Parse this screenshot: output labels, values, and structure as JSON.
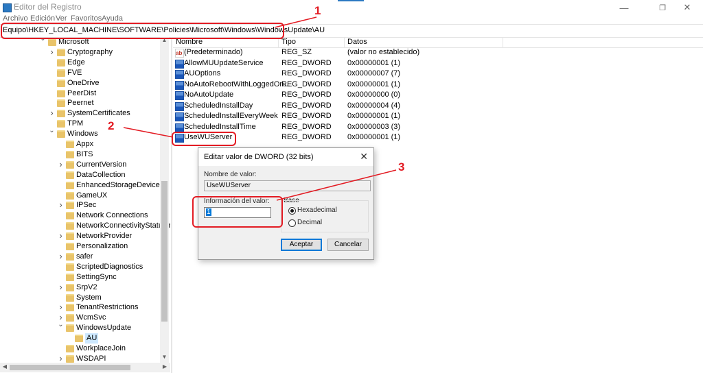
{
  "window": {
    "title": "Editor del Registro",
    "icons": {
      "app": "regedit-icon",
      "minimize": "minimize-icon",
      "maximize": "maximize-icon",
      "close": "close-icon"
    }
  },
  "menu": [
    "Archivo",
    "Edición",
    "Ver",
    "Favoritos",
    "Ayuda"
  ],
  "address": "Equipo\\HKEY_LOCAL_MACHINE\\SOFTWARE\\Policies\\Microsoft\\Windows\\WindowsUpdate\\AU",
  "tree": [
    {
      "label": "Microsoft",
      "expander": "expanded"
    },
    {
      "label": "Cryptography",
      "expander": "collapsed"
    },
    {
      "label": "Edge",
      "expander": "none"
    },
    {
      "label": "FVE",
      "expander": "none"
    },
    {
      "label": "OneDrive",
      "expander": "none"
    },
    {
      "label": "PeerDist",
      "expander": "none"
    },
    {
      "label": "Peernet",
      "expander": "none"
    },
    {
      "label": "SystemCertificates",
      "expander": "collapsed"
    },
    {
      "label": "TPM",
      "expander": "none"
    },
    {
      "label": "Windows",
      "expander": "expanded"
    },
    {
      "label": "Appx",
      "expander": "none"
    },
    {
      "label": "BITS",
      "expander": "none"
    },
    {
      "label": "CurrentVersion",
      "expander": "collapsed"
    },
    {
      "label": "DataCollection",
      "expander": "none"
    },
    {
      "label": "EnhancedStorageDevices",
      "expander": "none"
    },
    {
      "label": "GameUX",
      "expander": "none"
    },
    {
      "label": "IPSec",
      "expander": "collapsed"
    },
    {
      "label": "Network Connections",
      "expander": "none"
    },
    {
      "label": "NetworkConnectivityStatusInd",
      "expander": "none"
    },
    {
      "label": "NetworkProvider",
      "expander": "collapsed"
    },
    {
      "label": "Personalization",
      "expander": "none"
    },
    {
      "label": "safer",
      "expander": "collapsed"
    },
    {
      "label": "ScriptedDiagnostics",
      "expander": "none"
    },
    {
      "label": "SettingSync",
      "expander": "none"
    },
    {
      "label": "SrpV2",
      "expander": "collapsed"
    },
    {
      "label": "System",
      "expander": "none"
    },
    {
      "label": "TenantRestrictions",
      "expander": "collapsed"
    },
    {
      "label": "WcmSvc",
      "expander": "collapsed"
    },
    {
      "label": "WindowsUpdate",
      "expander": "expanded"
    },
    {
      "label": "AU",
      "expander": "none",
      "selected": true
    },
    {
      "label": "WorkplaceJoin",
      "expander": "none"
    },
    {
      "label": "WSDAPI",
      "expander": "collapsed"
    }
  ],
  "list": {
    "headers": {
      "name": "Nombre",
      "type": "Tipo",
      "data": "Datos"
    },
    "rows": [
      {
        "name": "(Predeterminado)",
        "type": "REG_SZ",
        "data": "(valor no establecido)",
        "icon": "string-value-icon"
      },
      {
        "name": "AllowMUUpdateService",
        "type": "REG_DWORD",
        "data": "0x00000001 (1)",
        "icon": "dword-value-icon"
      },
      {
        "name": "AUOptions",
        "type": "REG_DWORD",
        "data": "0x00000007 (7)",
        "icon": "dword-value-icon"
      },
      {
        "name": "NoAutoRebootWithLoggedOn...",
        "type": "REG_DWORD",
        "data": "0x00000001 (1)",
        "icon": "dword-value-icon"
      },
      {
        "name": "NoAutoUpdate",
        "type": "REG_DWORD",
        "data": "0x00000000 (0)",
        "icon": "dword-value-icon"
      },
      {
        "name": "ScheduledInstallDay",
        "type": "REG_DWORD",
        "data": "0x00000004 (4)",
        "icon": "dword-value-icon"
      },
      {
        "name": "ScheduledInstallEveryWeek",
        "type": "REG_DWORD",
        "data": "0x00000001 (1)",
        "icon": "dword-value-icon"
      },
      {
        "name": "ScheduledInstallTime",
        "type": "REG_DWORD",
        "data": "0x00000003 (3)",
        "icon": "dword-value-icon"
      },
      {
        "name": "UseWUServer",
        "type": "REG_DWORD",
        "data": "0x00000001 (1)",
        "icon": "dword-value-icon"
      }
    ]
  },
  "dialog": {
    "title": "Editar valor de DWORD (32 bits)",
    "name_label": "Nombre de valor:",
    "name_value": "UseWUServer",
    "data_label": "Información del valor:",
    "data_value": "1",
    "base_label": "Base",
    "base_options": [
      {
        "label": "Hexadecimal",
        "selected": true
      },
      {
        "label": "Decimal",
        "selected": false
      }
    ],
    "ok_label": "Aceptar",
    "cancel_label": "Cancelar"
  },
  "annotations": {
    "callouts": [
      "1",
      "2",
      "3"
    ],
    "color": "#e31b23"
  }
}
